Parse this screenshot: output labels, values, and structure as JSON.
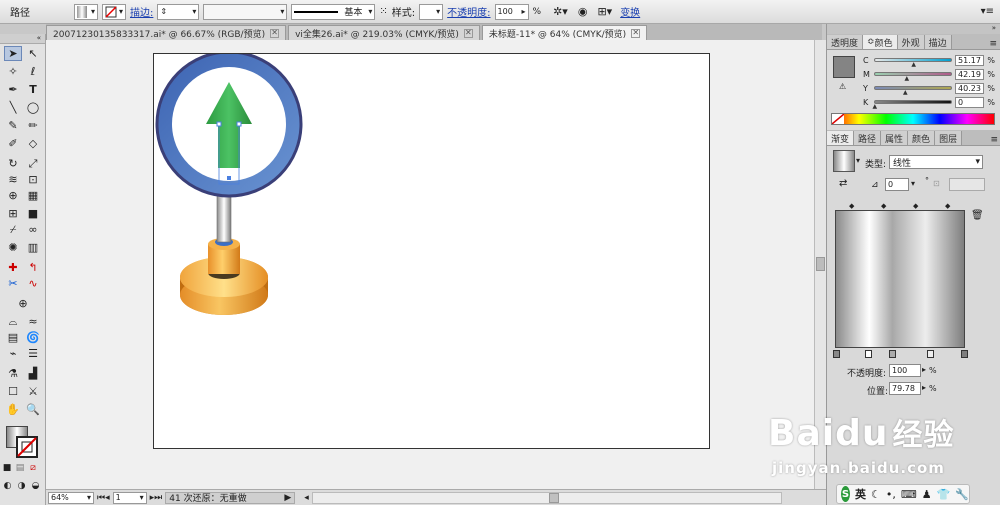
{
  "control_bar": {
    "object_type": "路径",
    "stroke_label": "描边:",
    "stroke_style": "基本",
    "style_label": "样式:",
    "opacity_label": "不透明度:",
    "opacity_value": "100",
    "opacity_unit": "%",
    "transform_label": "变换"
  },
  "tabs": [
    {
      "label": "20071230135833317.ai* @ 66.67% (RGB/预览)"
    },
    {
      "label": "vi全集26.ai* @ 219.03% (CMYK/预览)"
    },
    {
      "label": "未标题-11* @ 64% (CMYK/预览)"
    }
  ],
  "status_bar": {
    "zoom": "64%",
    "page": "1",
    "info": "41 次还原：无重做"
  },
  "color_panel": {
    "tabs": [
      "透明度",
      "颜色",
      "外观",
      "描边"
    ],
    "channels": [
      {
        "name": "C",
        "value": "51.17",
        "pos": 0.51
      },
      {
        "name": "M",
        "value": "42.19",
        "pos": 0.42
      },
      {
        "name": "Y",
        "value": "40.23",
        "pos": 0.4
      },
      {
        "name": "K",
        "value": "0",
        "pos": 0.0
      }
    ],
    "unit": "%"
  },
  "gradient_panel": {
    "tabs": [
      "渐变",
      "路径",
      "属性",
      "颜色",
      "图层"
    ],
    "type_label": "类型:",
    "type_value": "线性",
    "angle_value": "0",
    "degree_unit": "°",
    "opacity_label": "不透明度:",
    "opacity_value": "100",
    "location_label": "位置:",
    "location_value": "79.78",
    "pct": "%"
  },
  "watermark": {
    "brand": "Baidu",
    "brand_cn": "经验",
    "url": "jingyan.baidu.com"
  },
  "ime": {
    "mode": "英"
  }
}
